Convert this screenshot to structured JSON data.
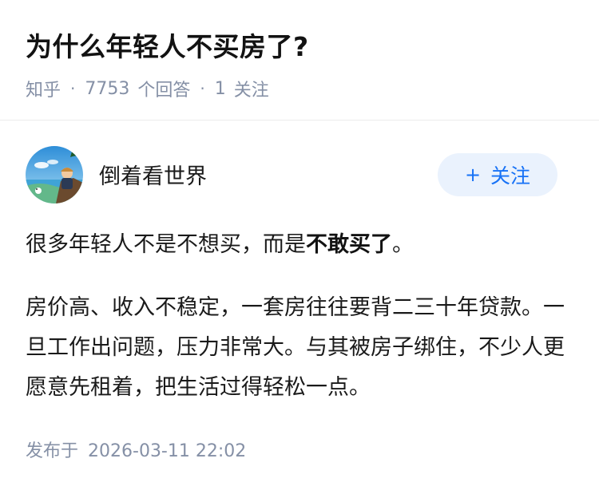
{
  "question": {
    "title": "为什么年轻人不买房了?",
    "source": "知乎",
    "answer_count": "7753",
    "answer_label": "个回答",
    "follower_count": "1",
    "follower_label": "关注"
  },
  "author": {
    "name": "倒着看世界",
    "follow_label": "关注",
    "follow_icon": "plus-icon"
  },
  "answer": {
    "p1_prefix": "很多年轻人不是不想买，而是",
    "p1_bold": "不敢买了",
    "p1_suffix": "。",
    "p2": "房价高、收入不稳定，一套房往往要背二三十年贷款。一旦工作出问题，压力非常大。与其被房子绑住，不少人更愿意先租着，把生活过得轻松一点。"
  },
  "footer": {
    "published_label": "发布于",
    "published_time": "2026-03-11 22:02"
  },
  "colors": {
    "meta_gray": "#8590a6",
    "brand_blue": "#1772f6",
    "button_bg": "#eaf2fd"
  }
}
